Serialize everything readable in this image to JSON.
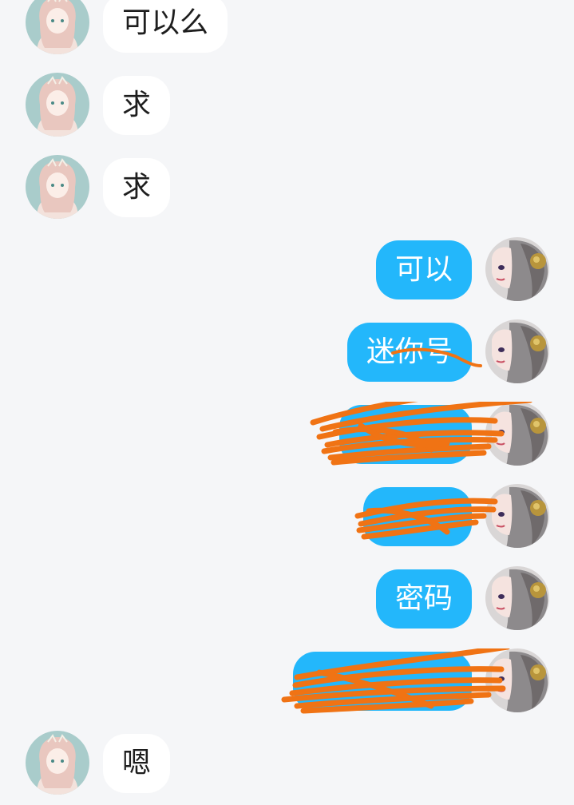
{
  "chat": {
    "messages": [
      {
        "side": "in",
        "text": "可以么"
      },
      {
        "side": "in",
        "text": "求"
      },
      {
        "side": "in",
        "text": "求"
      },
      {
        "side": "out",
        "text": "可以"
      },
      {
        "side": "out",
        "text": "迷你号"
      },
      {
        "side": "out",
        "text": ""
      },
      {
        "side": "out",
        "text": ""
      },
      {
        "side": "out",
        "text": "密码"
      },
      {
        "side": "out",
        "text": ""
      },
      {
        "side": "in",
        "text": "嗯"
      }
    ]
  },
  "colors": {
    "page_background": "#f5f6f8",
    "incoming_bubble": "#ffffff",
    "outgoing_bubble": "#23b7fb",
    "redaction_scribble": "#f07314"
  },
  "icons": {
    "contact_avatar": "anime-girl-pink-hair-avatar",
    "self_avatar": "grey-hair-woman-avatar"
  }
}
